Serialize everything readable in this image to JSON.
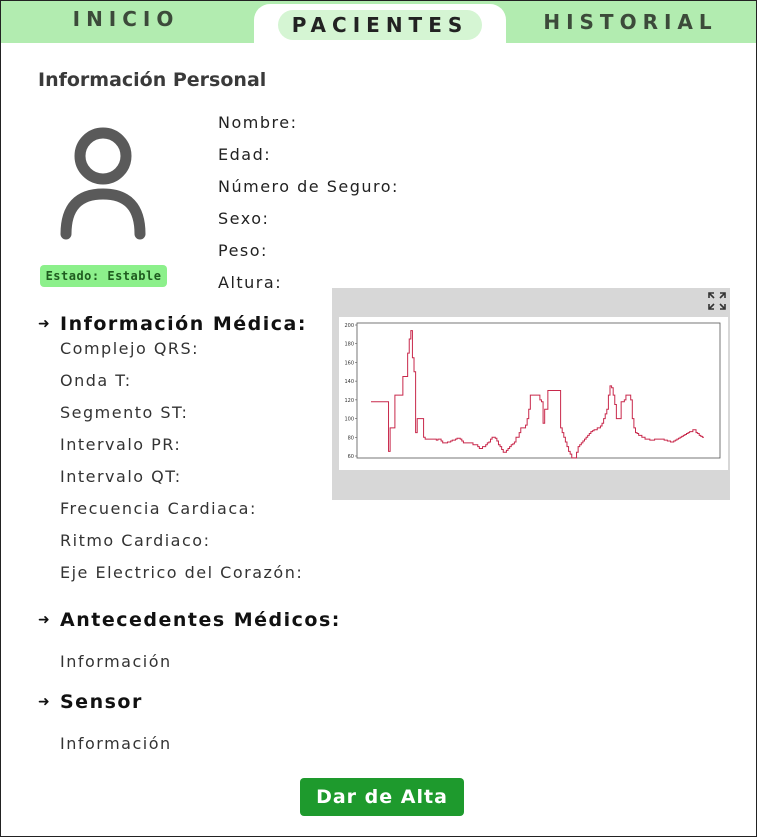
{
  "tabs": {
    "inicio": "INICIO",
    "pacientes": "PACIENTES",
    "historial": "HISTORIAL"
  },
  "personal": {
    "title": "Información Personal",
    "status": "Estado: Estable",
    "fields": [
      "Nombre:",
      "Edad:",
      "Número de Seguro:",
      "Sexo:",
      "Peso:",
      "Altura:"
    ]
  },
  "medical": {
    "heading": "Información Médica:",
    "fields": [
      "Complejo QRS:",
      "Onda T:",
      "Segmento ST:",
      "Intervalo PR:",
      "Intervalo QT:",
      "Frecuencia Cardiaca:",
      "Ritmo Cardiaco:",
      "Eje Electrico del Corazón:"
    ]
  },
  "antecedentes": {
    "heading": "Antecedentes Médicos:",
    "info": "Información"
  },
  "sensor": {
    "heading": "Sensor",
    "info": "Información"
  },
  "actions": {
    "discharge": "Dar de Alta"
  },
  "icons": {
    "avatar": "user-avatar-icon",
    "expand": "expand-icon",
    "arrow": "arrow-right-icon"
  },
  "colors": {
    "tabbar": "#b2ecb0",
    "status_badge": "#8cf08b",
    "button": "#1e9a2d",
    "line": "#c8284b"
  },
  "chart_data": {
    "type": "line",
    "ylim": [
      60,
      200
    ],
    "yticks": [
      60,
      80,
      100,
      120,
      140,
      160,
      180,
      200
    ],
    "y": [
      118,
      118,
      118,
      118,
      118,
      118,
      118,
      118,
      118,
      118,
      118,
      65,
      90,
      90,
      90,
      125,
      125,
      125,
      125,
      125,
      145,
      145,
      145,
      170,
      185,
      194,
      165,
      150,
      85,
      100,
      100,
      100,
      100,
      80,
      78,
      78,
      78,
      78,
      78,
      78,
      78,
      77,
      78,
      78,
      76,
      74,
      74,
      74,
      75,
      75,
      76,
      77,
      77,
      78,
      79,
      79,
      78,
      76,
      74,
      74,
      74,
      74,
      74,
      74,
      72,
      72,
      72,
      70,
      68,
      68,
      70,
      70,
      72,
      74,
      75,
      78,
      80,
      80,
      79,
      76,
      72,
      70,
      67,
      64,
      64,
      66,
      68,
      70,
      72,
      73,
      75,
      80,
      80,
      85,
      90,
      90,
      90,
      93,
      100,
      110,
      125,
      125,
      125,
      125,
      125,
      125,
      120,
      118,
      95,
      110,
      110,
      130,
      130,
      130,
      130,
      130,
      130,
      130,
      130,
      90,
      85,
      80,
      75,
      70,
      65,
      62,
      58,
      58,
      58,
      64,
      70,
      72,
      74,
      76,
      78,
      80,
      82,
      84,
      86,
      87,
      88,
      88,
      90,
      90,
      92,
      95,
      100,
      105,
      110,
      125,
      135,
      133,
      125,
      115,
      100,
      100,
      100,
      118,
      118,
      120,
      125,
      125,
      125,
      120,
      100,
      90,
      85,
      84,
      82,
      82,
      80,
      80,
      78,
      78,
      78,
      77,
      77,
      77,
      78,
      78,
      78,
      78,
      78,
      78,
      77,
      77,
      76,
      76,
      75,
      75,
      76,
      77,
      78,
      79,
      80,
      81,
      82,
      83,
      84,
      85,
      86,
      86,
      88,
      88,
      85,
      84,
      82,
      81,
      80,
      80
    ]
  }
}
